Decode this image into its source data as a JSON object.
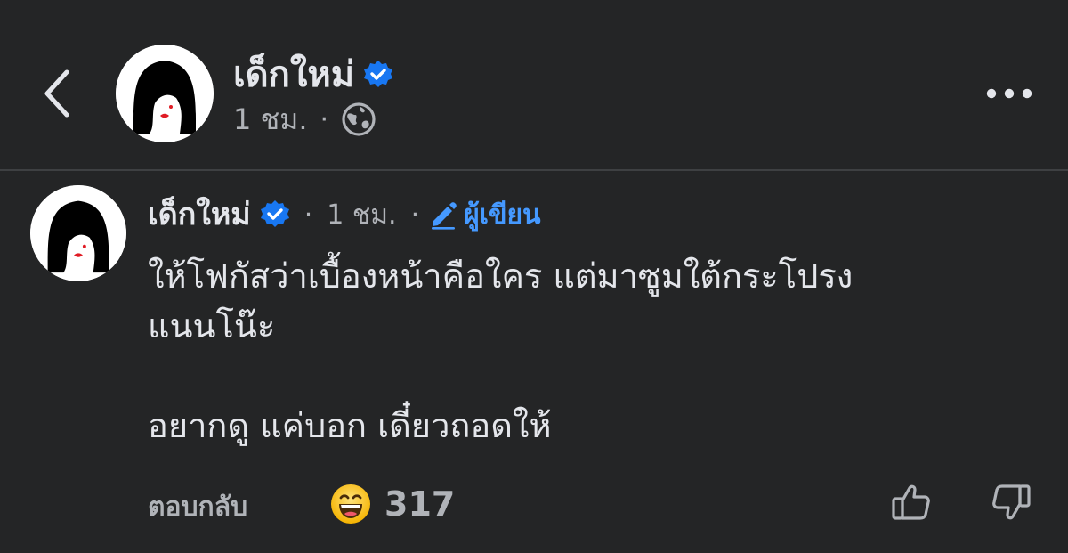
{
  "header": {
    "name": "เด็กใหม่",
    "time": "1 ชม.",
    "separator": "·",
    "back_icon": "chevron-left-icon",
    "privacy_icon": "globe-icon",
    "more_icon": "more-horizontal-icon"
  },
  "comment": {
    "author": "เด็กใหม่",
    "separator": "·",
    "time": "1 ชม.",
    "author_badge": "ผู้เขียน",
    "lines": [
      "ให้โฟกัสว่าเบื้องหน้าคือใคร แต่มาซูมใต้กระโปรง",
      "แนนโน๊ะ",
      "อยากดู แค่บอก เดี๋ยวถอดให้"
    ]
  },
  "actions": {
    "reply_label": "ตอบกลับ",
    "reaction_icon": "haha-emoji-icon",
    "reaction_count": "317",
    "like_icon": "thumbs-up-icon",
    "dislike_icon": "thumbs-down-icon"
  },
  "colors": {
    "background": "#242526",
    "primary_text": "#e4e6eb",
    "secondary_text": "#b0b3b8",
    "verified_blue": "#1877f2",
    "author_badge_blue": "#4599ff",
    "divider": "#3e4042"
  }
}
